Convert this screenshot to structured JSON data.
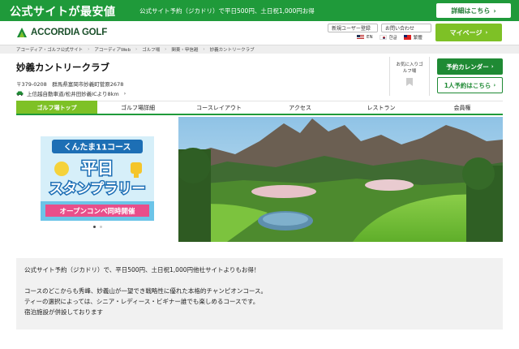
{
  "promo": {
    "title": "公式サイトが最安値",
    "text": "公式サイト予約（ジカドリ）で平日500円、土日祝1,000円お得",
    "button": "詳細はこちら"
  },
  "header": {
    "logo_text": "ACCORDIA GOLF",
    "links": [
      "新規ユーザー登録",
      "お問い合わせ"
    ],
    "languages": [
      "EN",
      "한글",
      "繁體"
    ],
    "mypage": "マイページ"
  },
  "breadcrumb": [
    "アコーディア・ゴルフ公式サイト",
    "アコーディアWeb",
    "ゴルフ場",
    "関東・甲信越",
    "妙義カントリークラブ"
  ],
  "course": {
    "name": "妙義カントリークラブ",
    "address": "〒379-0208　群馬県富岡市妙義町菅原2678",
    "access": "上信越自動車道/松井田妙義ICより8km",
    "favorite_label": "お気に入りゴルフ場",
    "calendar_button": "予約カレンダー",
    "single_button": "1人予約はこちら"
  },
  "tabs": [
    "ゴルフ場トップ",
    "ゴルフ場詳細",
    "コースレイアウト",
    "アクセス",
    "レストラン",
    "会員権"
  ],
  "banner": {
    "line1": "くんたま11コース",
    "line2": "平日",
    "line3": "スタンプラリー",
    "line4": "オープンコンペ同時開催"
  },
  "description": {
    "line1": "公式サイト予約（ジカドリ）で、平日500円、土日祝1,000円他社サイトよりもお得！",
    "line2": "コースのどこからも秀峰、妙義山が一望でき戦略性に優れた本格的チャンピオンコース。",
    "line3": "ティーの選択によっては、シニア・レディース・ビギナー誰でも楽しめるコースです。",
    "line4": "宿泊施設が併設しております"
  },
  "colors": {
    "brand_green": "#1f9a3a",
    "accent_lime": "#7ec126"
  }
}
